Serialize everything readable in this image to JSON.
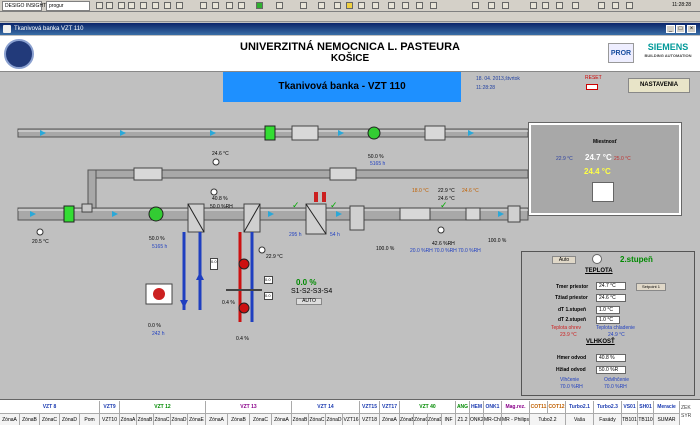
{
  "topbar": {
    "tab1": "DESIGO INSIGHT",
    "tab2": "progur",
    "clock": "11:28:28"
  },
  "window": {
    "title": "Tkanivová banka VZT 110"
  },
  "header": {
    "hospital": "UNIVERZITNÁ NEMOCNICA L. PASTEURA",
    "city": "KOŠICE",
    "partner": "PROR",
    "siemens": "SIEMENS",
    "siemens_sub": "BUILDING AUTOMATION"
  },
  "main": {
    "title": "Tkanivová banka - VZT 110",
    "date": "18. 04. 2013,štvrtok",
    "time": "11:28:28",
    "reset_label": "RESET",
    "settings_label": "NASTAVENIA"
  },
  "room": {
    "title": "Miestnosť",
    "left_temp": "22.9 °C",
    "main_temp": "24.7 °C",
    "right_temp": "25.0 °C",
    "yellow_temp": "24.4 °C"
  },
  "values": {
    "t_upper": "24.6 °C",
    "outside": "20.5 °C",
    "fan1_pct": "50.0 %",
    "fan1_flow": "5165 h",
    "fan2_pct": "50.0 %",
    "fan2_flow": "5165 h",
    "rh1": "40.8 %",
    "rh1b": "50.0 %RH",
    "pump_pct": "0.4 %",
    "heat_temp": "22.9 °C",
    "heat_pct": "0.4 %",
    "damper_pct": "0.0 %",
    "damper_flow": "242 h",
    "cooler_pct": "0.0 %",
    "cooler_flags": "S1-S2-S3-S4",
    "cooler_auto": "AUTO",
    "coil1_flow": "295 h",
    "coil2_flow": "54 h",
    "t_mid1": "18.0 °C",
    "t_mid2": "22.9 °C",
    "t_mid3": "24.6 °C",
    "t_mid4": "24.6 °C",
    "rh_mid": "42.6 %RH",
    "rh_mid2": "20.0 %RH",
    "rh_mid3": "70.0 %RH",
    "rh_mid4": "70.0 %RH",
    "damper2_pct": "100.0 %",
    "damper3_pct": "100.0 %",
    "box1": "0.0",
    "box2": "0.0",
    "box3": "0.0"
  },
  "control": {
    "auto_label": "Auto",
    "stage": "2.stupeň",
    "teplota_title": "TEPLOTA",
    "rows": [
      {
        "label": "Tmer priestor",
        "value": "24.7 °C"
      },
      {
        "label": "Tžiad priestor",
        "value": "24.6 °C"
      },
      {
        "label": "dT 1.stupeň",
        "value": "1.0 °C"
      },
      {
        "label": "dT 2.stupeň",
        "value": "1.0 °C"
      }
    ],
    "setpoint_btn": "Setpoint 1",
    "heat_label": "Teplota ohrev",
    "heat_value": "23.9 °C",
    "cool_label": "Teplota chladenie",
    "cool_value": "24.9 °C",
    "vlhkost_title": "VLHKOSŤ",
    "hum_rows": [
      {
        "label": "Hmer odvod",
        "value": "40.8 %"
      },
      {
        "label": "Hžiad odvod",
        "value": "50.0 %R"
      }
    ],
    "vlh_label": "Vlhčenie",
    "vlh_value": "70.0 %RH",
    "odvlh_label": "Odvlhčenie",
    "odvlh_value": "70.0 %RH"
  },
  "bottom": {
    "groups": [
      {
        "label": "VZT 8",
        "color": "#1a3ab0"
      },
      {
        "label": "VZT9",
        "color": "#1a3ab0"
      },
      {
        "label": "VZT 12",
        "color": "#008a00"
      },
      {
        "label": "VZT 13",
        "color": "#8a008a"
      },
      {
        "label": "VZT 14",
        "color": "#1a3ab0"
      },
      {
        "label": "VZT15",
        "color": "#1a3ab0"
      },
      {
        "label": "VZT17",
        "color": "#1a3ab0"
      },
      {
        "label": "VZT 40",
        "color": "#008a00"
      },
      {
        "label": "ANG",
        "color": "#008a00"
      },
      {
        "label": "HEM",
        "color": "#1a3ab0"
      },
      {
        "label": "ONK1",
        "color": "#1a3ab0"
      },
      {
        "label": "Mag.rez.",
        "color": "#8a008a"
      },
      {
        "label": "COT11",
        "color": "#c06000"
      },
      {
        "label": "COT12",
        "color": "#c06000"
      },
      {
        "label": "Turbo2.1",
        "color": "#1a3ab0"
      },
      {
        "label": "Turbo2.3",
        "color": "#1a3ab0"
      },
      {
        "label": "VS01",
        "color": "#1a3ab0"
      },
      {
        "label": "SH01",
        "color": "#1a3ab0"
      },
      {
        "label": "Meracie",
        "color": "#1a3ab0"
      }
    ],
    "cells": [
      "ZónaA",
      "ZónaB",
      "ZónaC",
      "ZónaD",
      "Pom",
      "VZT10",
      "ZónaA",
      "ZónaB",
      "ZónaC",
      "ZónaD",
      "ZónaE",
      "ZónaA",
      "ZónaB",
      "ZónaC",
      "ZónaA",
      "ZónaB",
      "ZónaC",
      "ZónaD",
      "VZT16",
      "VZT18",
      "ZónaA",
      "ZónaB",
      "ZónaC",
      "ZónaD",
      "INF",
      "Z1.2",
      "ONK2",
      "MR-Chlad",
      "MR - Philips",
      "Tubo2.2",
      "Vaša",
      "Fasády",
      "TB101",
      "TB110",
      "SUMAR"
    ],
    "corner": [
      "ZEK",
      "SYR"
    ]
  }
}
